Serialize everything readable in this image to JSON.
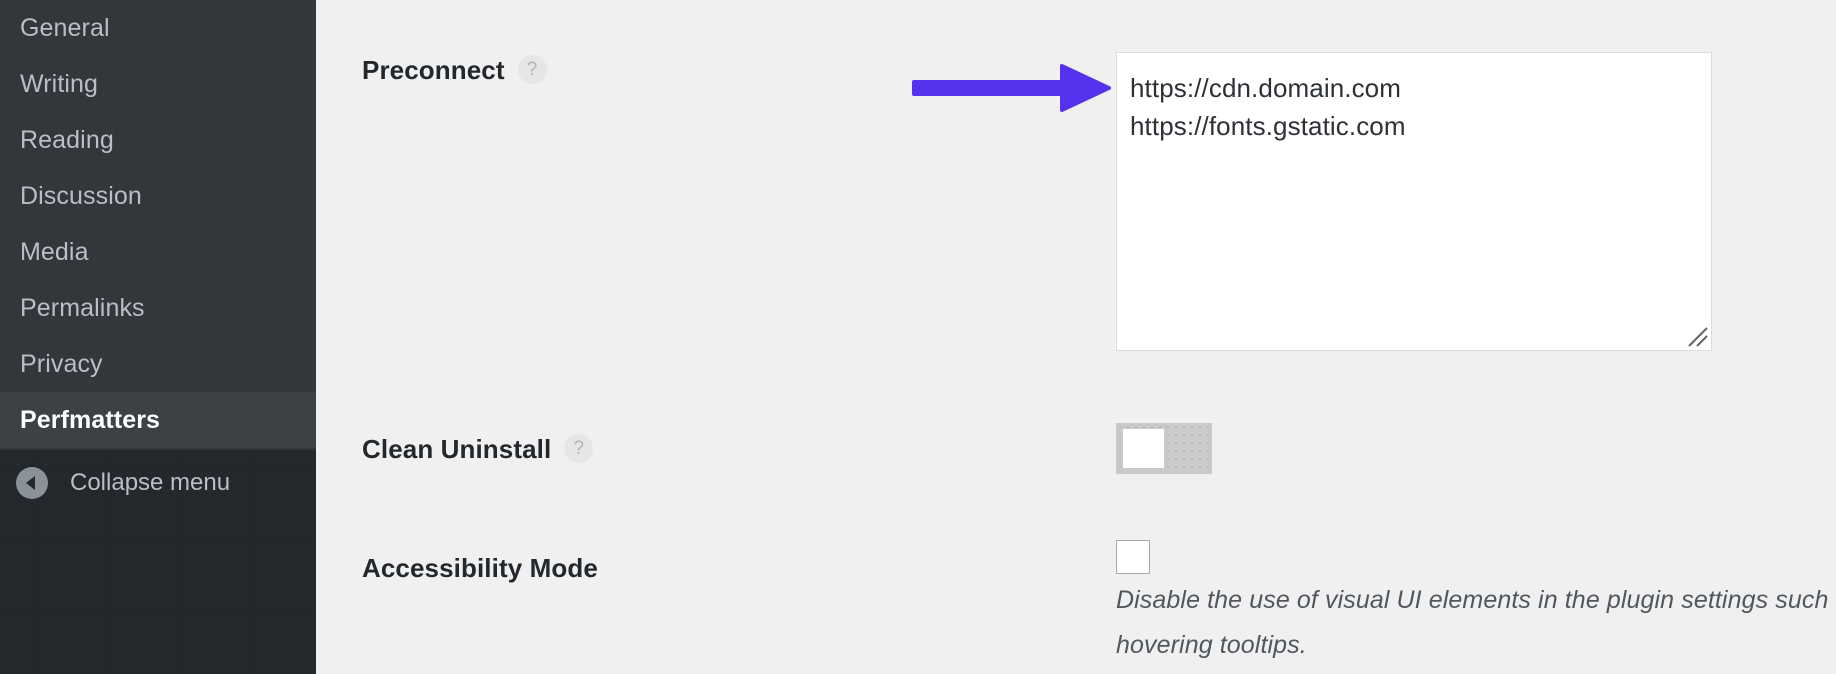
{
  "sidebar": {
    "items": [
      {
        "label": "General",
        "current": false
      },
      {
        "label": "Writing",
        "current": false
      },
      {
        "label": "Reading",
        "current": false
      },
      {
        "label": "Discussion",
        "current": false
      },
      {
        "label": "Media",
        "current": false
      },
      {
        "label": "Permalinks",
        "current": false
      },
      {
        "label": "Privacy",
        "current": false
      },
      {
        "label": "Perfmatters",
        "current": true
      }
    ],
    "collapse": {
      "label": "Collapse menu",
      "icon": "chevron-left-circle-icon"
    },
    "colors": {
      "background": "#32373c",
      "active_background": "#3c4145",
      "bottom_background": "#23282d",
      "text": "#b9bfc4",
      "active_text": "#ffffff"
    }
  },
  "main": {
    "background": "#f0f0f1",
    "annotation": {
      "type": "arrow",
      "direction": "right",
      "color": "#5533ee",
      "points_to": "preconnect-textarea"
    },
    "fields": [
      {
        "label": "Preconnect",
        "help_icon": "question-mark-icon",
        "control": "textarea",
        "value": "https://cdn.domain.com\nhttps://fonts.gstatic.com",
        "placeholder": "",
        "resizable": true
      },
      {
        "label": "Clean Uninstall",
        "help_icon": "question-mark-icon",
        "control": "toggle",
        "state": "off"
      },
      {
        "label": "Accessibility Mode",
        "help_icon": null,
        "control": "checkbox",
        "state": "unchecked",
        "description": "Disable the use of visual UI elements in the plugin settings such as checkbox toggles and hovering tooltips."
      }
    ]
  },
  "icons": {
    "help": "?",
    "resize_grip": "resize-handle-icon"
  }
}
